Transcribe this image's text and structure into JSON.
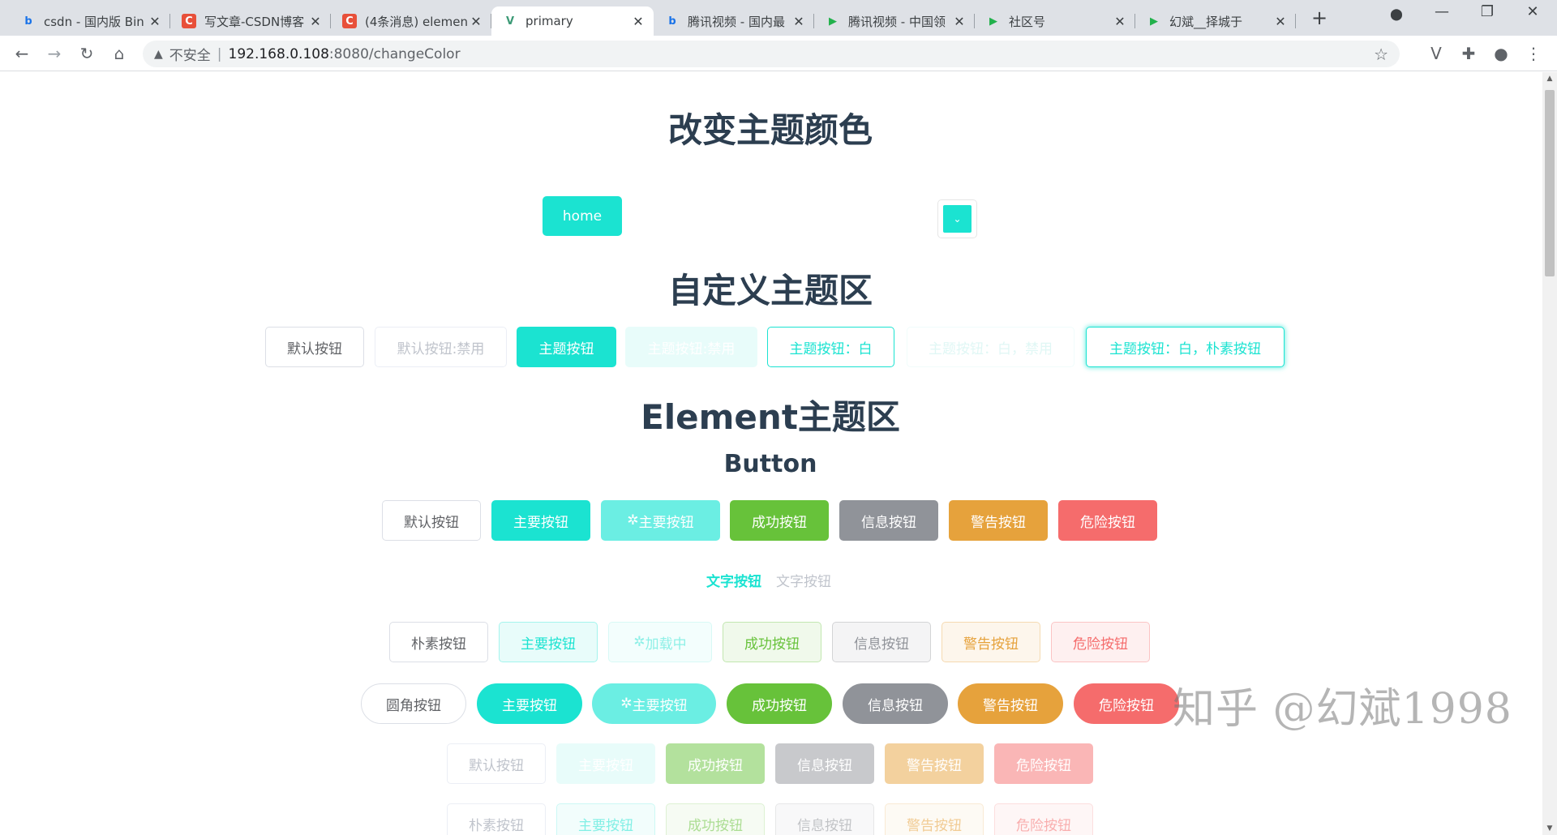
{
  "browser": {
    "tabs": [
      {
        "title": "csdn - 国内版 Bin",
        "icon": "bing-icon"
      },
      {
        "title": "写文章-CSDN博客",
        "icon": "csdn-icon"
      },
      {
        "title": "(4条消息) elemen",
        "icon": "csdn-icon"
      },
      {
        "title": "primary",
        "icon": "vue-icon",
        "active": true
      },
      {
        "title": "腾讯视频 - 国内最",
        "icon": "bing-icon"
      },
      {
        "title": "腾讯视频 - 中国领",
        "icon": "tencent-video-icon"
      },
      {
        "title": "社区号",
        "icon": "tencent-video-icon"
      },
      {
        "title": "幻斌__择城于",
        "icon": "tencent-video-icon"
      }
    ],
    "address": {
      "security_label": "不安全",
      "host": "192.168.0.108",
      "path": ":8080/changeColor"
    }
  },
  "page": {
    "title_change_color": "改变主题颜色",
    "home_label": "home",
    "theme_color": "#1be3d1",
    "title_custom": "自定义主题区",
    "custom_buttons": [
      "默认按钮",
      "默认按钮:禁用",
      "主题按钮",
      "主题按钮:禁用",
      "主题按钮：白",
      "主题按钮：白，禁用",
      "主题按钮：白，朴素按钮"
    ],
    "title_element": "Element主题区",
    "subtitle_button": "Button",
    "row_basic": [
      "默认按钮",
      "主要按钮",
      "主要按钮",
      "成功按钮",
      "信息按钮",
      "警告按钮",
      "危险按钮"
    ],
    "text_buttons": [
      "文字按钮",
      "文字按钮"
    ],
    "row_plain": [
      "朴素按钮",
      "主要按钮",
      "加载中",
      "成功按钮",
      "信息按钮",
      "警告按钮",
      "危险按钮"
    ],
    "row_round": [
      "圆角按钮",
      "主要按钮",
      "主要按钮",
      "成功按钮",
      "信息按钮",
      "警告按钮",
      "危险按钮"
    ],
    "row_disabled": [
      "默认按钮",
      "主要按钮",
      "成功按钮",
      "信息按钮",
      "警告按钮",
      "危险按钮"
    ],
    "row_disabled_plain": [
      "朴素按钮",
      "主要按钮",
      "成功按钮",
      "信息按钮",
      "警告按钮",
      "危险按钮"
    ],
    "colors": {
      "primary": "#1be3d1",
      "success": "#67c23a",
      "info": "#909399",
      "warning": "#e6a23c",
      "danger": "#f56c6c"
    },
    "watermark": "知乎 @幻斌1998"
  }
}
